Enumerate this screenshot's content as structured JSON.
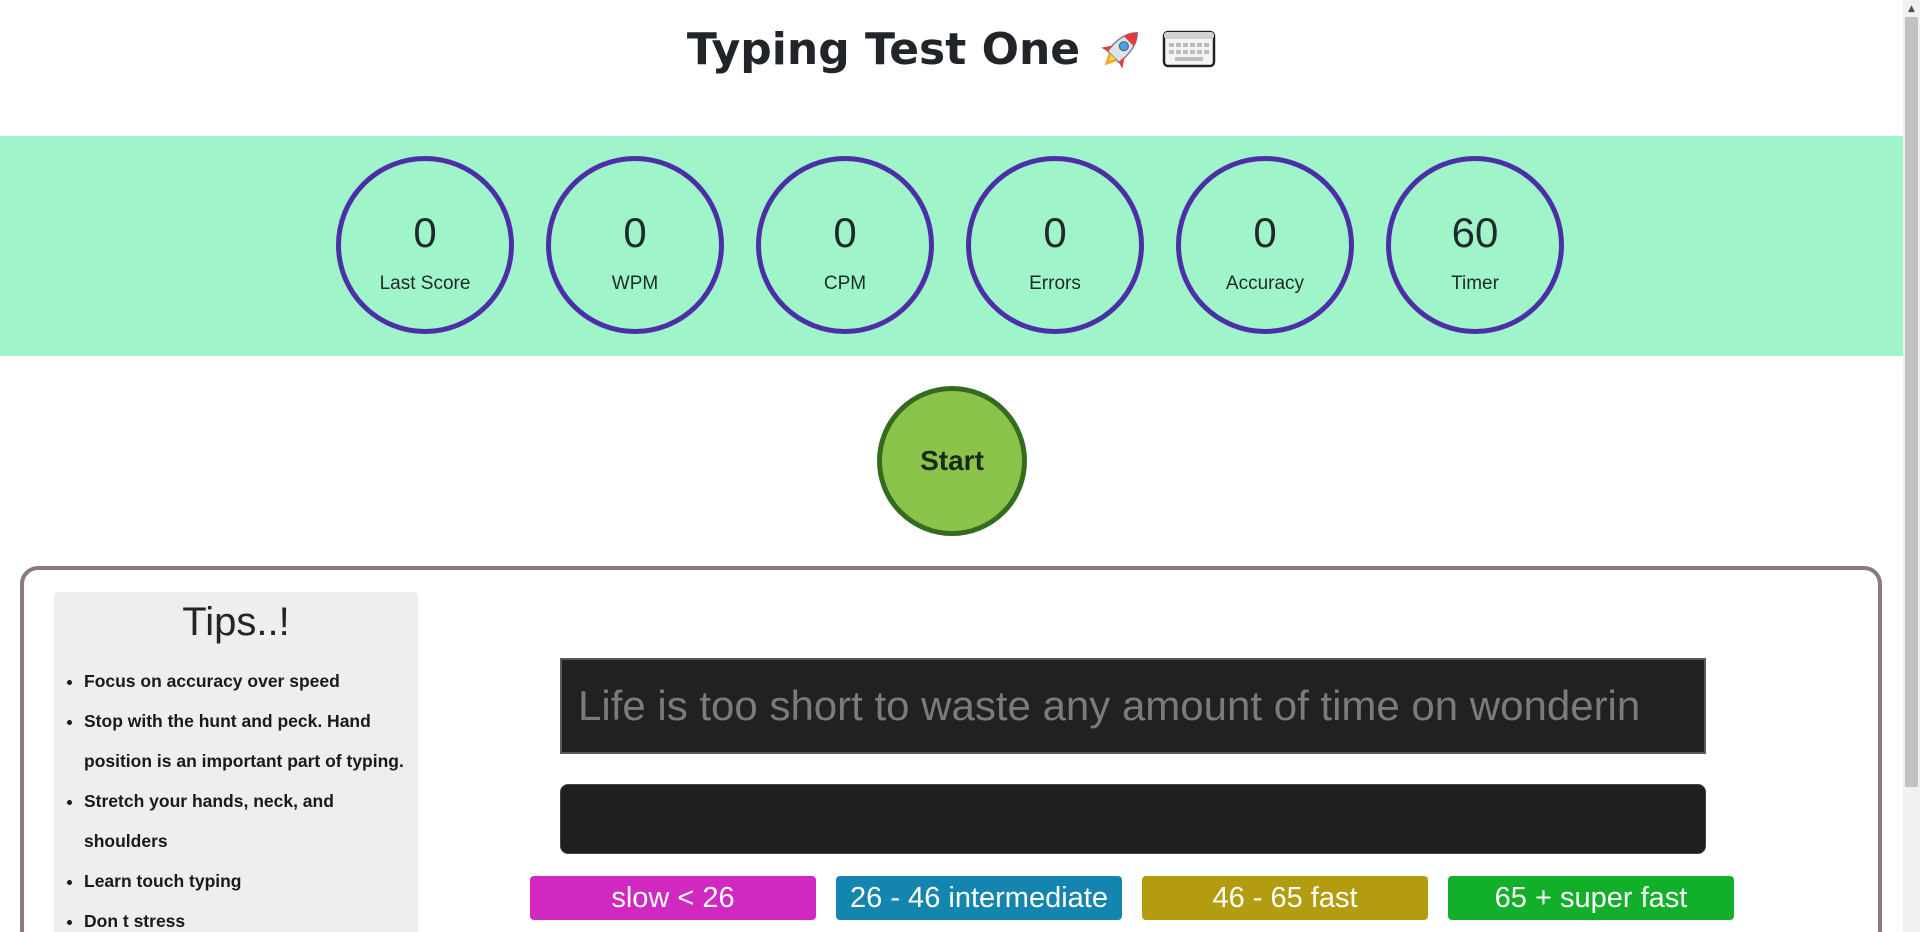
{
  "header": {
    "title": "Typing Test One",
    "icons": [
      "rocket-icon",
      "keyboard-icon"
    ]
  },
  "stats": [
    {
      "value": "0",
      "label": "Last Score"
    },
    {
      "value": "0",
      "label": "WPM"
    },
    {
      "value": "0",
      "label": "CPM"
    },
    {
      "value": "0",
      "label": "Errors"
    },
    {
      "value": "0",
      "label": "Accuracy"
    },
    {
      "value": "60",
      "label": "Timer"
    }
  ],
  "start_button": {
    "label": "Start"
  },
  "tips": {
    "title": "Tips..!",
    "items": [
      "Focus on accuracy over speed",
      "Stop with the hunt and peck. Hand position is an important part of typing.",
      "Stretch your hands, neck, and shoulders",
      "Learn touch typing",
      "Don t stress"
    ]
  },
  "quote": {
    "text": "Life is too short to waste any amount of time on wonderin"
  },
  "typing_input": {
    "value": "",
    "placeholder": ""
  },
  "legend": [
    {
      "label": "slow < 26",
      "color": "#d028c0"
    },
    {
      "label": "26 - 46 intermediate",
      "color": "#1385ae"
    },
    {
      "label": "46 - 65 fast",
      "color": "#b39c10"
    },
    {
      "label": "65 + super fast",
      "color": "#12b02a"
    }
  ],
  "colors": {
    "stats_band": "#9ff5c9",
    "circle_border": "#4c2ea6",
    "start_fill": "#8bc34a",
    "start_border": "#336b1f",
    "panel_border": "#8a7a80"
  }
}
